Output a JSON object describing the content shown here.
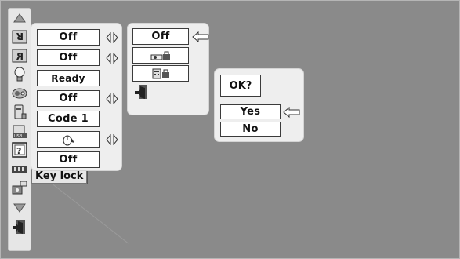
{
  "sidebar": {
    "icons": [
      "scroll-up-arrow-icon",
      "rear-ceiling-icon",
      "ceiling-icon",
      "lamp-icon",
      "fan-icon",
      "remote-control-icon",
      "usb-icon",
      "help-icon",
      "battery-icon",
      "security-icon",
      "scroll-down-arrow-icon",
      "exit-icon"
    ]
  },
  "settings_panel": {
    "rows": [
      {
        "value": "Off"
      },
      {
        "value": "Off"
      },
      {
        "value": "Ready"
      },
      {
        "value": "Off"
      },
      {
        "value": "Code 1"
      },
      {
        "value": ""
      },
      {
        "value": "Off"
      }
    ]
  },
  "tooltip": {
    "label": "Key lock"
  },
  "keylock_panel": {
    "selected": "Off"
  },
  "confirm_panel": {
    "question": "OK?",
    "yes": "Yes",
    "no": "No"
  },
  "colors": {
    "background": "#8a8a8a",
    "panel": "#eeeeee",
    "field": "#ffffff"
  }
}
